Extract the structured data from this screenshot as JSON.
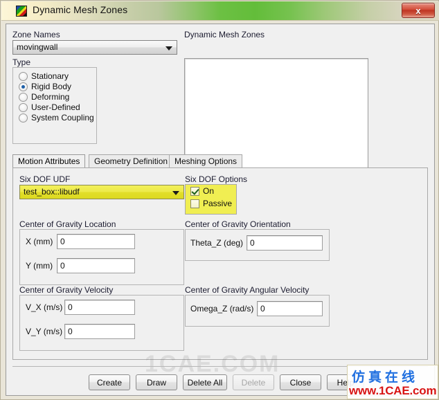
{
  "window": {
    "title": "Dynamic Mesh Zones",
    "icon": "fluent-app-icon",
    "close_label": "x"
  },
  "zone_names": {
    "label": "Zone Names",
    "value": "movingwall"
  },
  "type_group": {
    "label": "Type",
    "options": [
      {
        "label": "Stationary",
        "checked": false
      },
      {
        "label": "Rigid Body",
        "checked": true
      },
      {
        "label": "Deforming",
        "checked": false
      },
      {
        "label": "User-Defined",
        "checked": false
      },
      {
        "label": "System Coupling",
        "checked": false
      }
    ]
  },
  "zones_list": {
    "label": "Dynamic Mesh Zones",
    "items": []
  },
  "tabs": [
    {
      "label": "Motion Attributes",
      "active": true
    },
    {
      "label": "Geometry Definition",
      "active": false
    },
    {
      "label": "Meshing Options",
      "active": false
    }
  ],
  "six_dof_udf": {
    "label": "Six DOF UDF",
    "value": "test_box::libudf"
  },
  "six_dof_options": {
    "label": "Six DOF Options",
    "options": [
      {
        "label": "On",
        "checked": true
      },
      {
        "label": "Passive",
        "checked": false
      }
    ]
  },
  "cg_location": {
    "label": "Center of Gravity Location",
    "fields": [
      {
        "label": "X (mm)",
        "value": "0"
      },
      {
        "label": "Y (mm)",
        "value": "0"
      }
    ]
  },
  "cg_orientation": {
    "label": "Center of Gravity Orientation",
    "fields": [
      {
        "label": "Theta_Z (deg)",
        "value": "0"
      }
    ]
  },
  "cg_velocity": {
    "label": "Center of Gravity Velocity",
    "fields": [
      {
        "label": "V_X (m/s)",
        "value": "0"
      },
      {
        "label": "V_Y (m/s)",
        "value": "0"
      }
    ]
  },
  "cg_angular_velocity": {
    "label": "Center of Gravity Angular Velocity",
    "fields": [
      {
        "label": "Omega_Z (rad/s)",
        "value": "0"
      }
    ]
  },
  "buttons": [
    {
      "label": "Create",
      "disabled": false
    },
    {
      "label": "Draw",
      "disabled": false
    },
    {
      "label": "Delete All",
      "disabled": false
    },
    {
      "label": "Delete",
      "disabled": true
    },
    {
      "label": "Close",
      "disabled": false
    },
    {
      "label": "Help",
      "disabled": false
    }
  ],
  "watermark": {
    "center": "1CAE.COM",
    "chinese": "仿真在线",
    "url": "www.1CAE.com"
  },
  "colors": {
    "highlight_yellow": "#e2df2a",
    "titlebar_green": "#63bd3a",
    "close_red": "#bf3522",
    "radio_blue": "#1d5fa8"
  }
}
